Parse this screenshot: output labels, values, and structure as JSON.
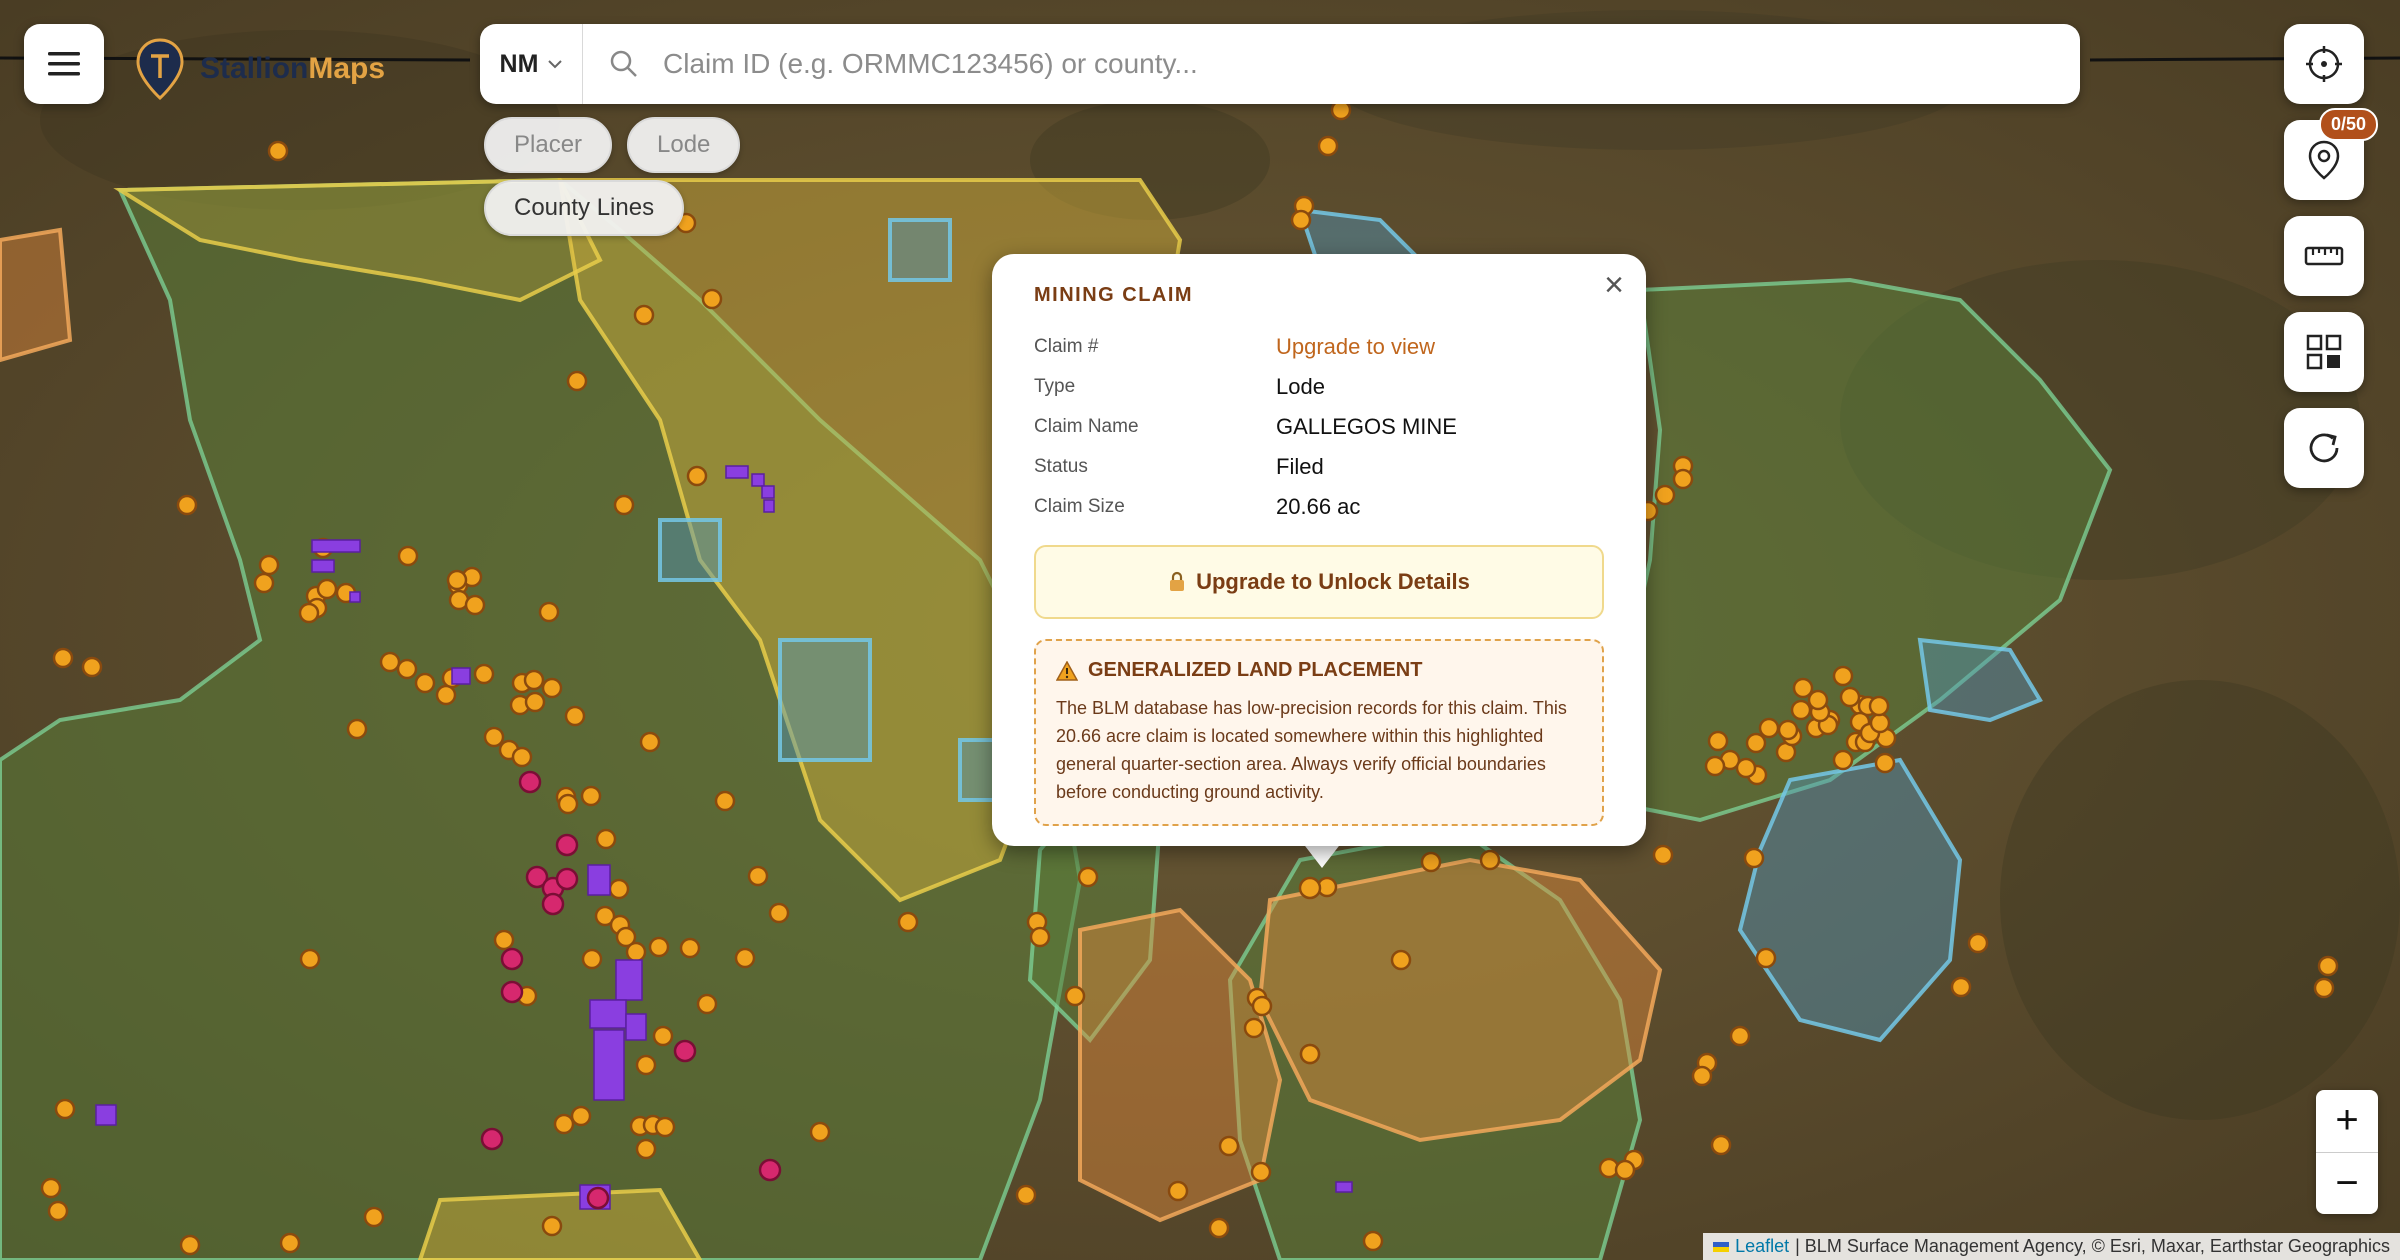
{
  "app": {
    "logo_name_part1": "Stallion",
    "logo_name_part2": "Maps"
  },
  "search": {
    "state": "NM",
    "placeholder": "Claim ID (e.g. ORMMC123456) or county..."
  },
  "filters": {
    "placer": "Placer",
    "lode": "Lode",
    "county_lines": "County Lines"
  },
  "toolbar": {
    "pins_badge": "0/50"
  },
  "popup": {
    "title": "MINING CLAIM",
    "fields": [
      {
        "label": "Claim #",
        "value": "Upgrade to view"
      },
      {
        "label": "Type",
        "value": "Lode"
      },
      {
        "label": "Claim Name",
        "value": "GALLEGOS MINE"
      },
      {
        "label": "Status",
        "value": "Filed"
      },
      {
        "label": "Claim Size",
        "value": "20.66 ac"
      }
    ],
    "upgrade_button": "Upgrade to Unlock Details",
    "warning_title": "GENERALIZED LAND PLACEMENT",
    "warning_body": "The BLM database has low-precision records for this claim. This 20.66 acre claim is located somewhere within this highlighted general quarter-section area. Always verify official boundaries before conducting ground activity."
  },
  "zoom": {
    "in": "+",
    "out": "−"
  },
  "attribution": {
    "leaflet": "Leaflet",
    "rest": "| BLM Surface Management Agency, © Esri, Maxar, Earthstar Geographics"
  },
  "colors": {
    "accent": "#c0661d",
    "brand_dark": "#1d2c4c",
    "brand_gold": "#e3a344",
    "blm_land": "#5a7e3a",
    "state_land": "#4f95b8",
    "private_land": "#d8b43c",
    "other_land": "#e0893c",
    "claim_marker": "#f0a21e",
    "lode_marker": "#8a3ee0",
    "placer_marker": "#d6286e"
  },
  "icons": {
    "menu": "menu-icon",
    "logo": "pin-logo-icon",
    "search": "search-icon",
    "locate": "crosshair-icon",
    "pins": "map-pin-icon",
    "measure": "ruler-icon",
    "layers": "grid-icon",
    "refresh": "refresh-icon",
    "lock": "lock-icon",
    "warning": "warning-icon"
  }
}
